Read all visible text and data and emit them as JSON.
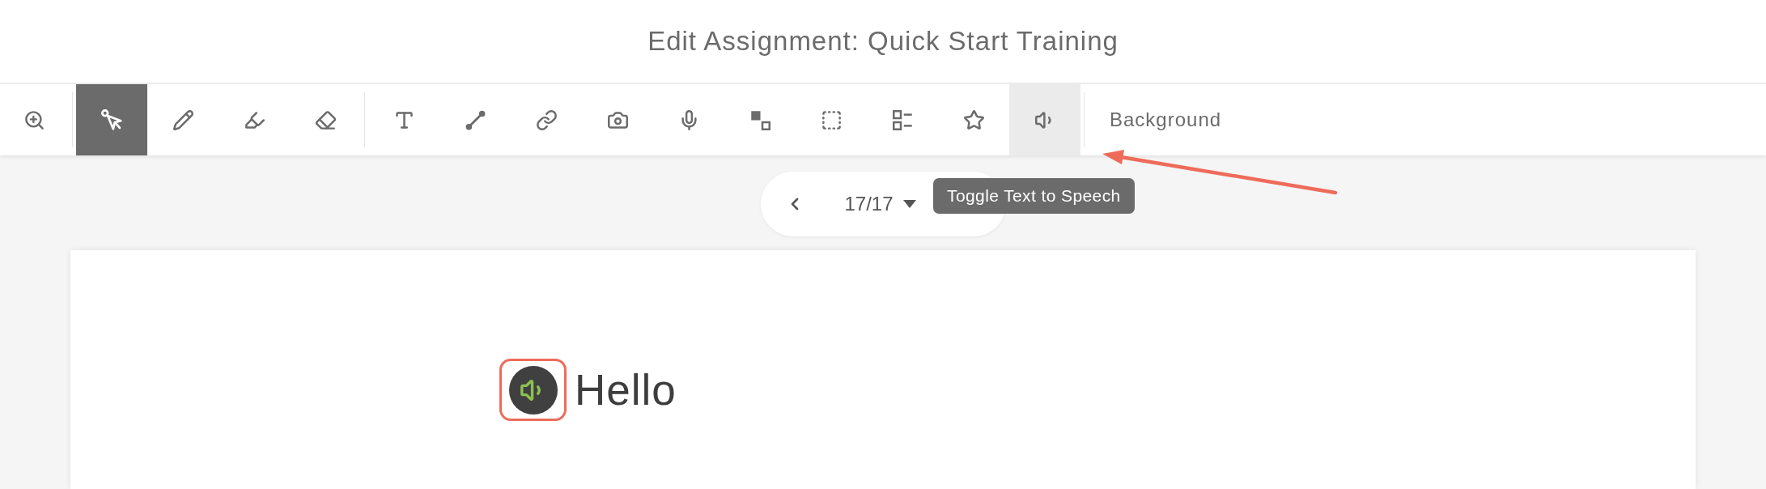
{
  "header": {
    "title": "Edit Assignment: Quick Start Training"
  },
  "toolbar": {
    "groups": [
      {
        "tools": [
          {
            "selected": false,
            "hovered": false
          }
        ]
      },
      {
        "tools": [
          {
            "selected": true,
            "hovered": false
          },
          {
            "selected": false,
            "hovered": false
          },
          {
            "selected": false,
            "hovered": false
          },
          {
            "selected": false,
            "hovered": false
          }
        ]
      },
      {
        "tools": [
          {
            "selected": false,
            "hovered": false
          },
          {
            "selected": false,
            "hovered": false
          },
          {
            "selected": false,
            "hovered": false
          },
          {
            "selected": false,
            "hovered": false
          },
          {
            "selected": false,
            "hovered": false
          },
          {
            "selected": false,
            "hovered": false
          },
          {
            "selected": false,
            "hovered": false
          },
          {
            "selected": false,
            "hovered": false
          },
          {
            "selected": false,
            "hovered": false
          },
          {
            "selected": false,
            "hovered": true
          }
        ]
      }
    ],
    "background_button": {
      "label": "Background"
    }
  },
  "pager": {
    "page": "17/17"
  },
  "tooltip": {
    "text": "Toggle Text to Speech"
  },
  "canvas": {
    "items": [
      {
        "kind": "text_to_speech",
        "text": "Hello",
        "highlighted": true
      }
    ]
  }
}
